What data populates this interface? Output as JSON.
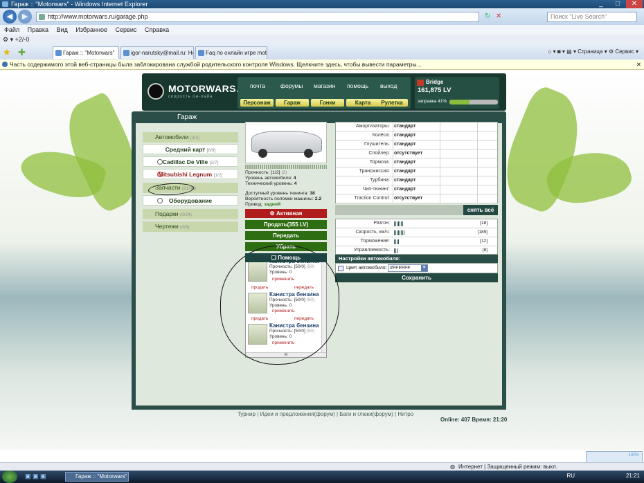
{
  "browser": {
    "window_title": "Гараж :: \"Motorwars\" - Windows Internet Explorer",
    "address": "http://www.motorwars.ru/garage.php",
    "search_placeholder": "Поиск \"Live Search\"",
    "menu": [
      "Файл",
      "Правка",
      "Вид",
      "Избранное",
      "Сервис",
      "Справка"
    ],
    "links_label": "+2/-0",
    "tabs": [
      "Гараж :: \"Motorwars\"",
      "igor-narutsky@mail.ru: Ho...",
      "Faq по онлайн игре moto..."
    ],
    "tools": [
      "Страница",
      "Сервис"
    ],
    "infobar": "Часть содержимого этой веб-страницы была заблокирована службой родительского контроля Windows. Щелкните здесь, чтобы вывести параметры...",
    "status_text": "Интернет | Защищенный режим: выкл.",
    "zoom": "100%"
  },
  "site": {
    "logo": "MOTORWARS.RU",
    "logo_sub": "скорость он-лайн",
    "nav_top": [
      "почта",
      "форумы",
      "магазин",
      "помощь",
      "выход"
    ],
    "nav_bottom": [
      "Персонаж",
      "Гараж",
      "Гонки",
      "Карта",
      "Рулетка"
    ],
    "player": {
      "name": "Bridge",
      "money": "161,875 LV",
      "fuel_label": "заправка 41%",
      "fuel_fraction": 0.41
    }
  },
  "garage": {
    "title": "Гараж",
    "sidebar": {
      "cars_label": "Автомобили",
      "cars_count": "(3/4)",
      "cars": [
        {
          "name": "Средний карт",
          "count": "[6/9]"
        },
        {
          "name": "Cadillac De Ville",
          "count": "[2/7]"
        },
        {
          "name": "Mitsubishi Legnum",
          "count": "[1/2]"
        }
      ],
      "parts_label": "Запчасти",
      "parts_count": "(21/30)",
      "equipment_label": "Оборудование",
      "gifts_label": "Подарки",
      "gifts_count": "(0/24)",
      "drawings_label": "Чертежи",
      "drawings_count": "(0/3)"
    },
    "car_info": {
      "durability_label": "Прочность:",
      "durability_value": "[1/2]",
      "durability_extra": "(2)",
      "level_label": "Уровень автомобиля:",
      "level_value": "4",
      "tech_label": "Технический уровень:",
      "tech_value": "4",
      "tuning_label": "Доступный уровень тюнинга:",
      "tuning_value": "38",
      "breakdown_label": "Вероятность поломки машины:",
      "breakdown_value": "2.2",
      "drive_label": "Привод:",
      "drive_value": "задний"
    },
    "buttons": {
      "active": "Активная",
      "sell": "Продать(355 LV)",
      "transfer": "Передать",
      "extra": "Убрать",
      "help": "Помощь"
    },
    "shop_items": [
      {
        "name": "Канистра бензина",
        "durability": "Прочность: [50/0]",
        "extra": "(50)",
        "level": "Уровень: 0",
        "apply": "применить",
        "sell": "продать",
        "transfer": "передать"
      },
      {
        "name": "Канистра бензина",
        "durability": "Прочность: [50/0]",
        "extra": "(50)",
        "level": "Уровень: 0",
        "apply": "применить",
        "sell": "продать",
        "transfer": "передать"
      },
      {
        "name": "Канистра бензина",
        "durability": "Прочность: [50/0]",
        "extra": "(50)",
        "level": "Уровень: 0",
        "apply": "применить",
        "sell": "",
        "transfer": ""
      }
    ],
    "attributes": [
      {
        "label": "Амортизаторы:",
        "value": "стандарт"
      },
      {
        "label": "Колёса:",
        "value": "стандарт"
      },
      {
        "label": "Глушитель:",
        "value": "стандарт"
      },
      {
        "label": "Спойлер:",
        "value": "отсутствует"
      },
      {
        "label": "Тормоза:",
        "value": "стандарт"
      },
      {
        "label": "Трансмиссия:",
        "value": "стандарт"
      },
      {
        "label": "Турбина:",
        "value": "стандарт"
      },
      {
        "label": "Чип-тюнинг:",
        "value": "стандарт"
      },
      {
        "label": "Traction Control:",
        "value": "отсутствует"
      }
    ],
    "reset_all": "снять всё",
    "performance": [
      {
        "label": "Разгон:",
        "value": "[18]",
        "fraction": 0.09
      },
      {
        "label": "Скорость, км/ч:",
        "value": "[189]",
        "fraction": 0.11
      },
      {
        "label": "Торможение:",
        "value": "[12]",
        "fraction": 0.06
      },
      {
        "label": "Управляемость:",
        "value": "[8]",
        "fraction": 0.04
      }
    ],
    "settings_title": "Настройки автомобиля:",
    "color_label": "Цвет автомобиля:",
    "color_value": "#FFFFFF",
    "save": "Сохранить"
  },
  "footer": {
    "links": [
      "Турнир",
      "Идеи и предложения(форум)",
      "Баги и глюки(форум)",
      "Нитро"
    ],
    "online_label": "Online:",
    "online_value": "407",
    "time_label": "Время:",
    "time_value": "21:20"
  },
  "taskbar": {
    "task": "Гараж :: \"Motorwars\"",
    "lang": "RU",
    "clock": "21:21"
  }
}
